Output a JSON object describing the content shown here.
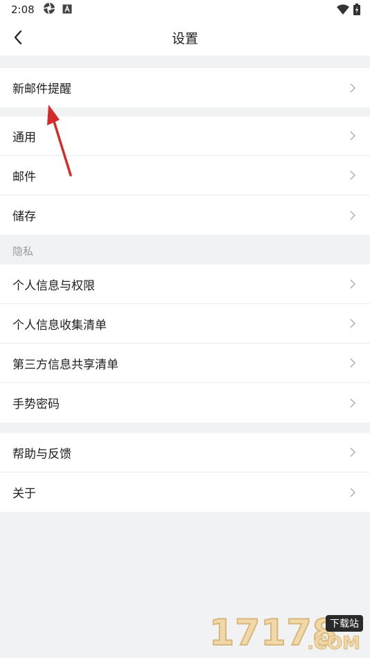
{
  "status_bar": {
    "time": "2:08",
    "left_icons": [
      "aperture-icon",
      "a-badge-icon"
    ],
    "right_icons": [
      "wifi-icon",
      "battery-charging-icon"
    ]
  },
  "nav": {
    "back_icon": "chevron-left-icon",
    "title": "设置"
  },
  "groups": [
    {
      "items": [
        {
          "label": "新邮件提醒"
        }
      ]
    },
    {
      "items": [
        {
          "label": "通用"
        },
        {
          "label": "邮件"
        },
        {
          "label": "储存"
        }
      ]
    },
    {
      "header": "隐私",
      "items": [
        {
          "label": "个人信息与权限"
        },
        {
          "label": "个人信息收集清单"
        },
        {
          "label": "第三方信息共享清单"
        },
        {
          "label": "手势密码"
        }
      ]
    },
    {
      "items": [
        {
          "label": "帮助与反馈"
        },
        {
          "label": "关于"
        }
      ]
    }
  ],
  "annotation": {
    "type": "red-arrow",
    "color": "#d62a2a"
  },
  "watermark": {
    "number": "17178",
    "tag": "下载站",
    "suffix": ".COM"
  },
  "colors": {
    "background": "#f1f2f4",
    "surface": "#ffffff",
    "chevron": "#b5b5b5",
    "header_text": "#9a9a9a"
  }
}
